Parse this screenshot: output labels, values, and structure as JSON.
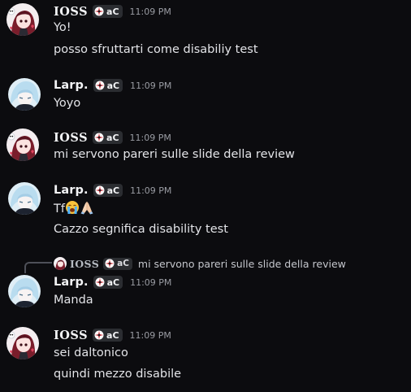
{
  "colors": {
    "background": "#0c0c0f",
    "username": "#f2f3f5",
    "message_text": "#e3e4e8",
    "timestamp": "#9a9ca3",
    "tag_background": "#2b2d31"
  },
  "messages": [
    {
      "author": "IOSS",
      "tag": "aC",
      "time": "11:09 PM",
      "avatar": "anime-girl-red-hair-avatar",
      "lines": [
        "Yo!",
        "posso sfruttarti come disabiliy test"
      ]
    },
    {
      "author": "Larp.",
      "tag": "aC",
      "time": "11:09 PM",
      "avatar": "anime-white-hair-avatar",
      "lines": [
        "Yoyo"
      ]
    },
    {
      "author": "IOSS",
      "tag": "aC",
      "time": "11:09 PM",
      "avatar": "anime-girl-red-hair-avatar",
      "lines": [
        "mi servono pareri sulle slide della review"
      ]
    },
    {
      "author": "Larp.",
      "tag": "aC",
      "time": "11:09 PM",
      "avatar": "anime-white-hair-avatar",
      "lines": [
        "Tf",
        "Cazzo segnifica disability test"
      ],
      "emojis": [
        "loudly-crying-face-emoji",
        "folded-hands-emoji"
      ]
    },
    {
      "author": "Larp.",
      "tag": "aC",
      "time": "11:09 PM",
      "avatar": "anime-white-hair-avatar",
      "reply": {
        "author": "IOSS",
        "tag": "aC",
        "text": "mi servono pareri sulle slide della review"
      },
      "lines": [
        "Manda"
      ]
    },
    {
      "author": "IOSS",
      "tag": "aC",
      "time": "11:09 PM",
      "avatar": "anime-girl-red-hair-avatar",
      "lines": [
        "sei daltonico",
        "quindi mezzo disabile"
      ]
    }
  ]
}
